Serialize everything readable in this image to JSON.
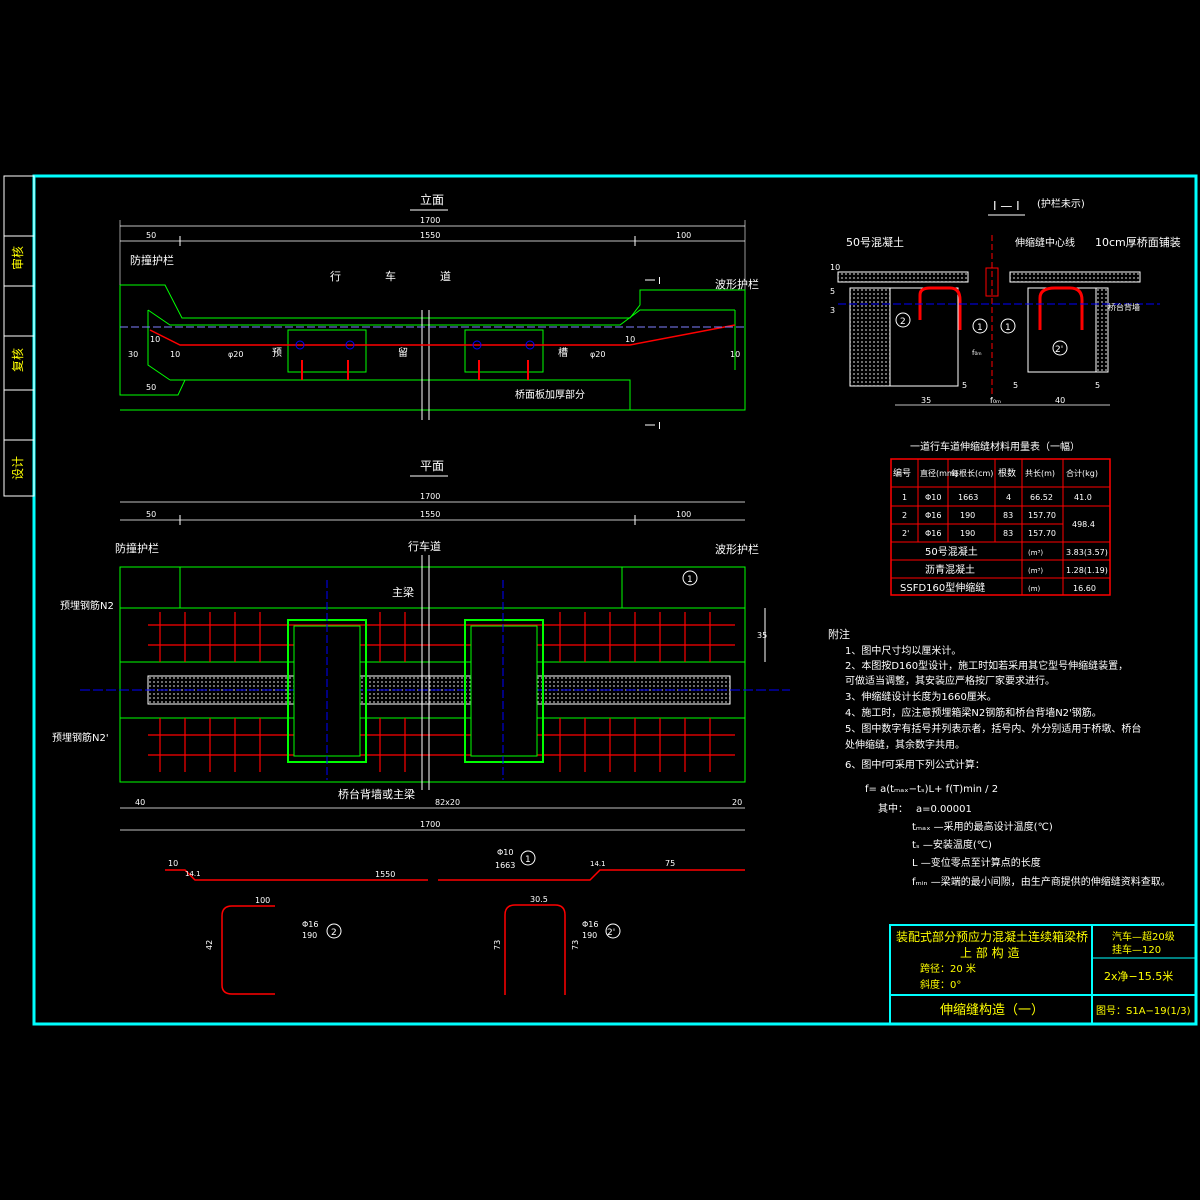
{
  "side_labels": [
    "审核",
    "复核",
    "设计"
  ],
  "elevation": {
    "title": "立面",
    "total": "1700",
    "left": "50",
    "mid": "1550",
    "right": "100",
    "left_label": "防撞护栏",
    "right_label": "波形护栏",
    "road": [
      "行",
      "车",
      "道"
    ],
    "slot": [
      "预",
      "留",
      "槽"
    ],
    "bottom_note": "桥面板加厚部分",
    "dims": [
      "30",
      "10",
      "10",
      "φ20",
      "φ20",
      "10",
      "10",
      "50"
    ],
    "section_mark": "I"
  },
  "plan": {
    "title": "平面",
    "total": "1700",
    "left": "50",
    "mid": "1550",
    "right": "100",
    "left_label": "防撞护栏",
    "right_label": "波形护栏",
    "road_label": "行车道",
    "main_beam": "主梁",
    "rebar_n2": "预埋钢筋N2",
    "rebar_n2p": "预埋钢筋N2'",
    "abutment": "桥台背墙或主梁",
    "dim_35": "35",
    "side_note": "预埋钢筋N2 桥台背墙或主梁",
    "circle": "1",
    "b_left": "40",
    "b_right": "20",
    "b_mid": "82x20",
    "b_total": "1700"
  },
  "bars": {
    "n1": {
      "d1": "10",
      "d2": "14.1",
      "mid": "1550",
      "d3": "14.1",
      "d4": "75",
      "dia": "Φ10",
      "len": "1663",
      "id": "1"
    },
    "n2": {
      "w": "100",
      "h": "42",
      "dia": "Φ16",
      "len": "190",
      "id": "2"
    },
    "n2p": {
      "w": "30.5",
      "h1": "73",
      "h2": "73",
      "dia": "Φ16",
      "len": "190",
      "id": "2'"
    }
  },
  "section": {
    "title": "I — I",
    "note": "(护栏未示)",
    "concrete": "50号混凝土",
    "center": "伸缩缝中心线",
    "pave": "10cm厚桥面铺装",
    "dims": [
      "10",
      "5",
      "3",
      "35",
      "5",
      "f₀ₘ",
      "5",
      "40",
      "5",
      "f₀ₘ"
    ],
    "labels": [
      "2",
      "1",
      "1",
      "2'"
    ],
    "side": "桥台背墙"
  },
  "table": {
    "title": "一道行车道伸缩缝材料用量表（一幅）",
    "headers": [
      "编号",
      "直径(mm)",
      "每根长(cm)",
      "根数",
      "共长(m)",
      "合计(kg)"
    ],
    "rows": [
      [
        "1",
        "Φ10",
        "1663",
        "4",
        "66.52",
        "41.0"
      ],
      [
        "2",
        "Φ16",
        "190",
        "83",
        "157.70",
        "498.4"
      ],
      [
        "2'",
        "Φ16",
        "190",
        "83",
        "157.70",
        ""
      ]
    ],
    "extra": [
      [
        "50号混凝土",
        "(m³)",
        "3.83(3.57)"
      ],
      [
        "沥青混凝土",
        "(m³)",
        "1.28(1.19)"
      ],
      [
        "SSFD160型伸缩缝",
        "(m)",
        "16.60"
      ]
    ]
  },
  "notes": {
    "title": "附注",
    "lines": [
      "1、图中尺寸均以厘米计。",
      "2、本图按D160型设计，施工时如若采用其它型号伸缩缝装置，",
      "    可做适当调整，其安装应严格按厂家要求进行。",
      "3、伸缩缝设计长度为1660厘米。",
      "4、施工时，应注意预埋箱梁N2钢筋和桥台背墙N2'钢筋。",
      "5、图中数字有括号并列表示者，括号内、外分别适用于桥墩、桥台",
      "    处伸缩缝，其余数字共用。",
      "6、图中f可采用下列公式计算："
    ],
    "formula": "f= a(tₘₐₓ−tₛ)L+ f(T)min / 2",
    "where": "其中：",
    "alpha": "a=0.00001",
    "defs": [
      "tₘₐₓ —采用的最高设计温度(℃)",
      "tₛ —安装温度(℃)",
      "L —变位零点至计算点的长度",
      "fₘᵢₙ —梁端的最小间隙，由生产商提供的伸缩缝资料查取。"
    ]
  },
  "titleblock": {
    "project": "装配式部分预应力混凝土连续箱梁桥",
    "part": "上 部 构 造",
    "load1": "汽车—超20级",
    "load2": "挂车—120",
    "span": "跨径：20 米",
    "width": "2x净−15.5米",
    "skew": "斜度：0°",
    "name": "伸缩缝构造（一）",
    "drawing_no": "图号：S1A−19(1/3)"
  },
  "colors": {
    "frame": "#00ffff",
    "line": "#00ff00",
    "rebar": "#ff0000",
    "text": "#ffffff",
    "title": "#ffff00"
  }
}
